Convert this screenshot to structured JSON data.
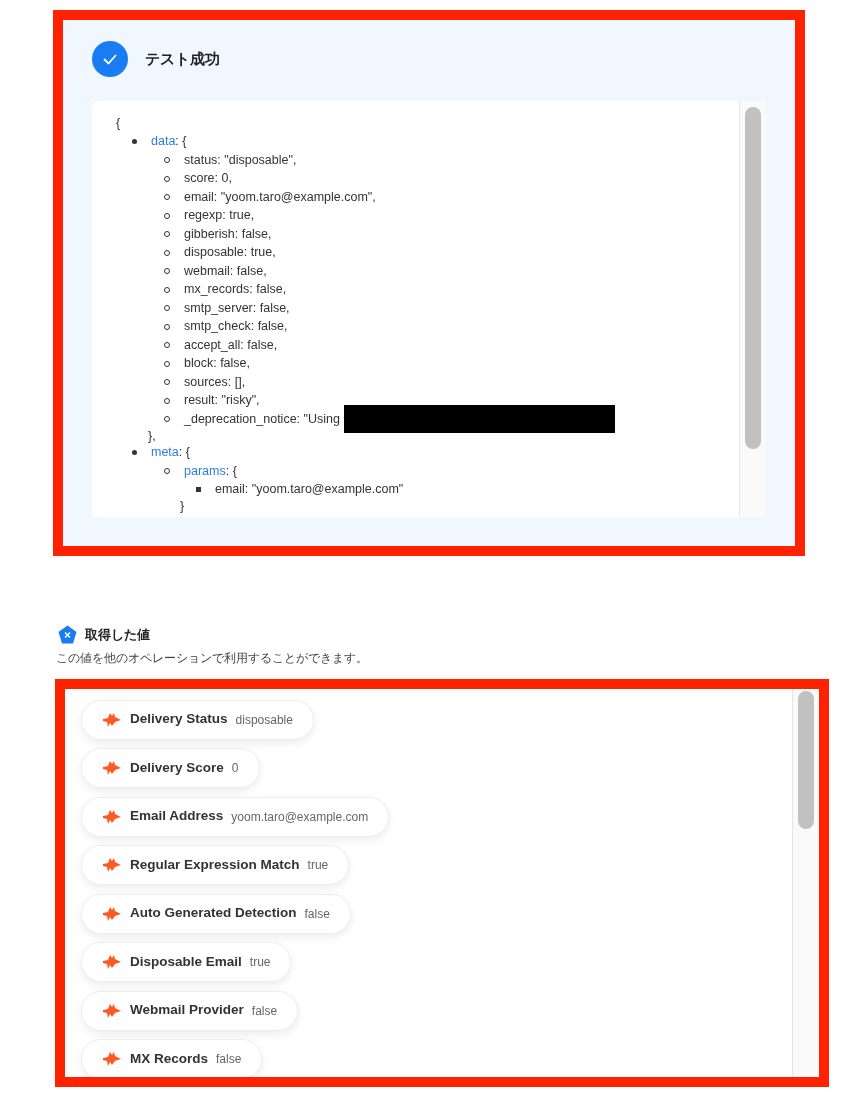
{
  "test_result": {
    "title": "テスト成功",
    "code": {
      "open": "{",
      "items": [
        {
          "key": "data",
          "suffix": ": {",
          "close": "},",
          "children": [
            {
              "text": "status: \"disposable\","
            },
            {
              "text": "score: 0,"
            },
            {
              "text": "email: \"yoom.taro@example.com\","
            },
            {
              "text": "regexp: true,"
            },
            {
              "text": "gibberish: false,"
            },
            {
              "text": "disposable: true,"
            },
            {
              "text": "webmail: false,"
            },
            {
              "text": "mx_records: false,"
            },
            {
              "text": "smtp_server: false,"
            },
            {
              "text": "smtp_check: false,"
            },
            {
              "text": "accept_all: false,"
            },
            {
              "text": "block: false,"
            },
            {
              "text": "sources: [],"
            },
            {
              "text": "result: \"risky\","
            },
            {
              "text": "_deprecation_notice: \"Using",
              "redacted": true
            }
          ]
        },
        {
          "key": "meta",
          "suffix": ": {",
          "children": [
            {
              "key": "params",
              "suffix": ": {",
              "close": "}",
              "children": [
                {
                  "text": "email: \"yoom.taro@example.com\""
                }
              ]
            }
          ]
        }
      ]
    }
  },
  "obtained_values": {
    "title": "取得した値",
    "description": "この値を他のオペレーションで利用することができます。",
    "items": [
      {
        "label": "Delivery Status",
        "value": "disposable"
      },
      {
        "label": "Delivery Score",
        "value": "0"
      },
      {
        "label": "Email Address",
        "value": "yoom.taro@example.com"
      },
      {
        "label": "Regular Expression Match",
        "value": "true"
      },
      {
        "label": "Auto Generated Detection",
        "value": "false"
      },
      {
        "label": "Disposable Email",
        "value": "true"
      },
      {
        "label": "Webmail Provider",
        "value": "false"
      },
      {
        "label": "MX Records",
        "value": "false"
      }
    ]
  }
}
